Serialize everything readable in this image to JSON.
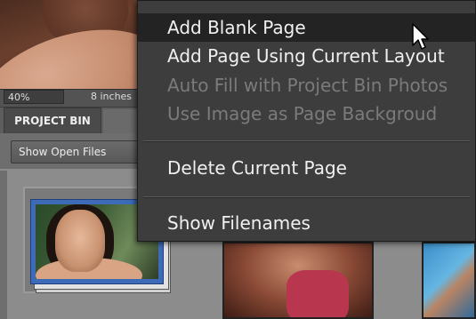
{
  "status_bar": {
    "zoom": "40%",
    "size": "8 inches"
  },
  "bin": {
    "tab_label": "PROJECT BIN",
    "show_select_value": "Show Open Files"
  },
  "context_menu": {
    "items": [
      {
        "label": "Add Blank Page",
        "enabled": true,
        "highlighted": true
      },
      {
        "label": "Add Page Using Current Layout",
        "enabled": true
      },
      {
        "label": "Auto Fill with Project Bin Photos",
        "enabled": false
      },
      {
        "label": "Use Image as Page Backgroud",
        "enabled": false
      },
      {
        "label": "Delete Current Page",
        "enabled": true
      },
      {
        "label": "Show Filenames",
        "enabled": true
      }
    ]
  },
  "icons": {
    "cursor": "arrow-cursor-icon"
  }
}
